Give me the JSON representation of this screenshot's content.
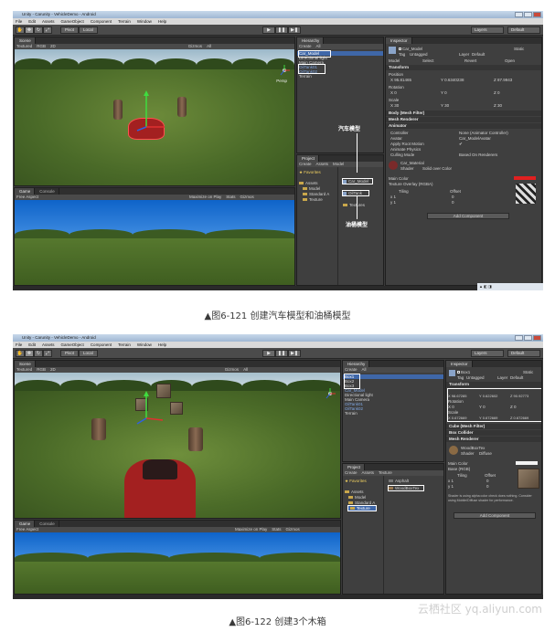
{
  "screens": [
    {
      "title_bar": "Unity - Carunity - VehicleDemo - Android",
      "menu": [
        "File",
        "Edit",
        "Assets",
        "GameObject",
        "Component",
        "Terrain",
        "Window",
        "Help"
      ],
      "toolbar": {
        "pivot": "Pivot",
        "global": "Local",
        "layers": "Layers",
        "layout": "Default"
      },
      "scene_tab": "Scene",
      "scene_bar": [
        "Textured",
        "RGB",
        "2D",
        "Gizmos",
        "All"
      ],
      "persp": "Persp",
      "game_tab": "Game",
      "console_tab": "Console",
      "game_bar": [
        "Free Aspect",
        "Maximize on Play",
        "Stats",
        "Gizmos"
      ],
      "hierarchy_tab": "Hierarchy",
      "hierarchy_bar": [
        "Create",
        "All"
      ],
      "hierarchy_items": [
        "Car_Model",
        "Directional light",
        "Main Camera",
        "OilTank01",
        "OilTank02",
        "Terrain"
      ],
      "project_tab": "Project",
      "project_bar": [
        "Create",
        "Assets",
        "Model"
      ],
      "project_tree": [
        "Favorites",
        "Assets",
        "Model",
        "Standard A",
        "Texture"
      ],
      "project_files": [
        "Car_Model",
        "OilTank",
        "Textures"
      ],
      "anno_car": "汽车模型",
      "anno_oil": "油桶模型",
      "inspector_tab": "Inspector",
      "inspector": {
        "object_name": "Car_Model",
        "static": "Static",
        "tag_label": "Tag",
        "tag": "Untagged",
        "layer_label": "Layer",
        "layer": "Default",
        "model_row": [
          "Model",
          "Select",
          "Revert",
          "Open"
        ],
        "transform": "Transform",
        "position_label": "Position",
        "position": [
          "X  95.81465",
          "Y  0.6340238",
          "Z  87.9943"
        ],
        "rotation_label": "Rotation",
        "rotation": [
          "X  0",
          "Y  0",
          "Z  0"
        ],
        "scale_label": "Scale",
        "scale": [
          "X  30",
          "Y  30",
          "Z  30"
        ],
        "components": [
          "Body (Mesh Filter)",
          "Mesh Renderer",
          "Animator"
        ],
        "animator_fields": [
          [
            "Controller",
            "None (Animator Controller)"
          ],
          [
            "Avatar",
            "Car_ModelAvatar"
          ],
          [
            "Apply Root Motion",
            "✔"
          ],
          [
            "Animate Physics",
            ""
          ],
          [
            "Culling Mode",
            "Based On Renderers"
          ]
        ],
        "material": "Car_Material",
        "shader": "Shader",
        "shader_value": "Solid over Color",
        "main_color": "Main Color",
        "texture_overlay": "Texture Overlay (RGBA)",
        "tiling": "Tiling",
        "offset": "Offset",
        "tiling_x": "x  1",
        "tiling_y": "y  1",
        "offset_x": "0",
        "offset_y": "0",
        "add_component": "Add Component"
      },
      "colors": {
        "selection": "#3f67a8",
        "main_color": "#e02020"
      }
    },
    {
      "title_bar": "Unity - Carunity - VehicleDemo - Android",
      "menu": [
        "File",
        "Edit",
        "Assets",
        "GameObject",
        "Component",
        "Terrain",
        "Window",
        "Help"
      ],
      "toolbar": {
        "pivot": "Pivot",
        "global": "Local",
        "layers": "Layers",
        "layout": "Default"
      },
      "scene_tab": "Scene",
      "scene_bar": [
        "Textured",
        "RGB",
        "2D",
        "Gizmos",
        "All"
      ],
      "game_tab": "Game",
      "console_tab": "Console",
      "game_bar": [
        "Free Aspect",
        "Maximize on Play",
        "Stats",
        "Gizmos"
      ],
      "hierarchy_tab": "Hierarchy",
      "hierarchy_bar": [
        "Create",
        "All"
      ],
      "hierarchy_items": [
        "Box1",
        "Box2",
        "Box3",
        "Car_Model",
        "Directional light",
        "Main Camera",
        "OilTank01",
        "OilTank02",
        "Terrain"
      ],
      "project_tab": "Project",
      "project_bar": [
        "Create",
        "Assets",
        "Texture"
      ],
      "project_tree": [
        "Favorites",
        "Assets",
        "Model",
        "Standard A",
        "Texture"
      ],
      "project_files": [
        "Asphalt",
        "WoodBoxTex"
      ],
      "inspector_tab": "Inspector",
      "inspector": {
        "object_name": "Box1",
        "static": "Static",
        "tag_label": "Tag",
        "tag": "Untagged",
        "layer_label": "Layer",
        "layer": "Default",
        "transform": "Transform",
        "position": [
          "X  98.67285",
          "Y  0.622602",
          "Z  90.92773"
        ],
        "rotation_label": "Rotation",
        "rotation": [
          "X  0",
          "Y  0",
          "Z  0"
        ],
        "scale_label": "Scale",
        "scale": [
          "X  0.672669",
          "Y  0.672669",
          "Z  0.672669"
        ],
        "components": [
          "Cube (Mesh Filter)",
          "Box Collider",
          "Mesh Renderer"
        ],
        "material": "WoodBoxTex",
        "shader": "Shader",
        "shader_value": "Diffuse",
        "main_color": "Main Color",
        "base": "Base (RGB)",
        "tiling": "Tiling",
        "offset": "Offset",
        "tiling_x": "x  1",
        "tiling_y": "y  1",
        "offset_x": "0",
        "offset_y": "0",
        "note": "Shader is using alpha color check does nothing. Consider using Mobile/Diffuse shader for performance.",
        "add_component": "Add Component"
      },
      "colors": {
        "selection": "#3f67a8",
        "main_color": "#f2f2f2"
      }
    }
  ],
  "captions": [
    "▲图6-121 创建汽车模型和油桶模型",
    "▲图6-122 创建3个木箱"
  ],
  "watermark": "云栖社区 yq.aliyun.com"
}
